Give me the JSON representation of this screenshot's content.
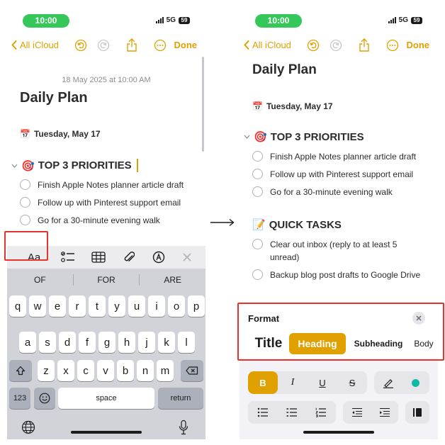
{
  "status": {
    "time": "10:00",
    "network": "5G",
    "battery": "59"
  },
  "nav": {
    "back_label": "All iCloud",
    "done_label": "Done"
  },
  "note": {
    "date": "18 May 2025 at 10:00 AM",
    "title": "Daily Plan",
    "day": "Tuesday, May 17",
    "day_emoji": "📅",
    "priorities_emoji": "🎯",
    "priorities_heading": "TOP 3 PRIORITIES",
    "priorities": [
      "Finish Apple Notes planner article draft",
      "Follow up with Pinterest support email",
      "Go for a 30-minute evening walk"
    ],
    "tasks_emoji": "📝",
    "tasks_heading": "QUICK TASKS",
    "tasks": [
      "Clear out inbox (reply to at least 5 unread)",
      "Backup blog post drafts to Google Drive"
    ]
  },
  "toolbar": {
    "format_label": "Aa"
  },
  "keyboard": {
    "suggestions": [
      "OF",
      "FOR",
      "ARE"
    ],
    "row1": [
      "q",
      "w",
      "e",
      "r",
      "t",
      "y",
      "u",
      "i",
      "o",
      "p"
    ],
    "row2": [
      "a",
      "s",
      "d",
      "f",
      "g",
      "h",
      "j",
      "k",
      "l"
    ],
    "row3": [
      "z",
      "x",
      "c",
      "v",
      "b",
      "n",
      "m"
    ],
    "numbers_label": "123",
    "space_label": "space",
    "return_label": "return"
  },
  "format_panel": {
    "label": "Format",
    "styles": [
      "Title",
      "Heading",
      "Subheading",
      "Body"
    ],
    "selected_style": "Heading",
    "text_styles": [
      "B",
      "I",
      "U",
      "S"
    ]
  },
  "colors": {
    "accent": "#e0a100",
    "highlight": "#e8322e",
    "status_green": "#35c759",
    "checklist_teal": "#10b9a6"
  }
}
